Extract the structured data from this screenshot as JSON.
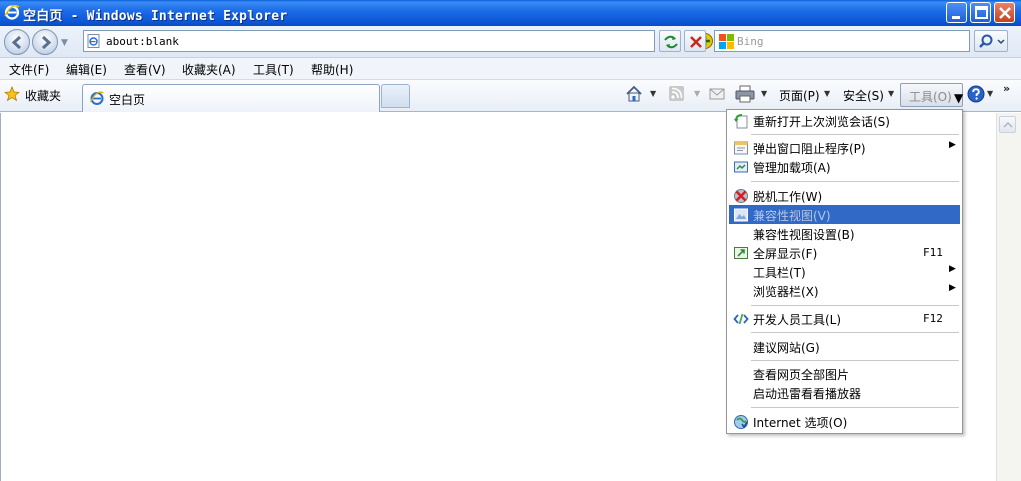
{
  "window": {
    "title": "空白页 - Windows Internet Explorer"
  },
  "address": {
    "value": "about:blank",
    "search_placeholder": "Bing"
  },
  "menubar": [
    "文件(F)",
    "编辑(E)",
    "查看(V)",
    "收藏夹(A)",
    "工具(T)",
    "帮助(H)"
  ],
  "commandbar": {
    "favorites_label": "收藏夹",
    "tab_label": "空白页",
    "page_label": "页面(P)",
    "safety_label": "安全(S)",
    "tools_label": "工具(O)",
    "chevron": "»"
  },
  "tools_menu": {
    "items": [
      {
        "label": "重新打开上次浏览会话(S)",
        "icon": "reopen-session-icon"
      },
      {
        "label": "弹出窗口阻止程序(P)",
        "icon": "popup-blocker-icon",
        "submenu": true
      },
      {
        "label": "管理加载项(A)",
        "icon": "addons-icon"
      },
      {
        "label": "脱机工作(W)",
        "icon": "offline-icon"
      },
      {
        "label": "兼容性视图(V)",
        "icon": "compat-view-icon",
        "highlighted": true,
        "disabled": true
      },
      {
        "label": "兼容性视图设置(B)"
      },
      {
        "label": "全屏显示(F)",
        "icon": "fullscreen-icon",
        "shortcut": "F11"
      },
      {
        "label": "工具栏(T)",
        "submenu": true
      },
      {
        "label": "浏览器栏(X)",
        "submenu": true
      },
      {
        "label": "开发人员工具(L)",
        "icon": "dev-tools-icon",
        "shortcut": "F12"
      },
      {
        "label": "建议网站(G)"
      },
      {
        "label": "查看网页全部图片"
      },
      {
        "label": "启动迅雷看看播放器"
      },
      {
        "label": "Internet 选项(O)",
        "icon": "internet-options-icon"
      }
    ],
    "submenu_arrow": "▶"
  },
  "colors": {
    "titlebar": "#0b56d6",
    "menu_highlight": "#3169c6"
  }
}
